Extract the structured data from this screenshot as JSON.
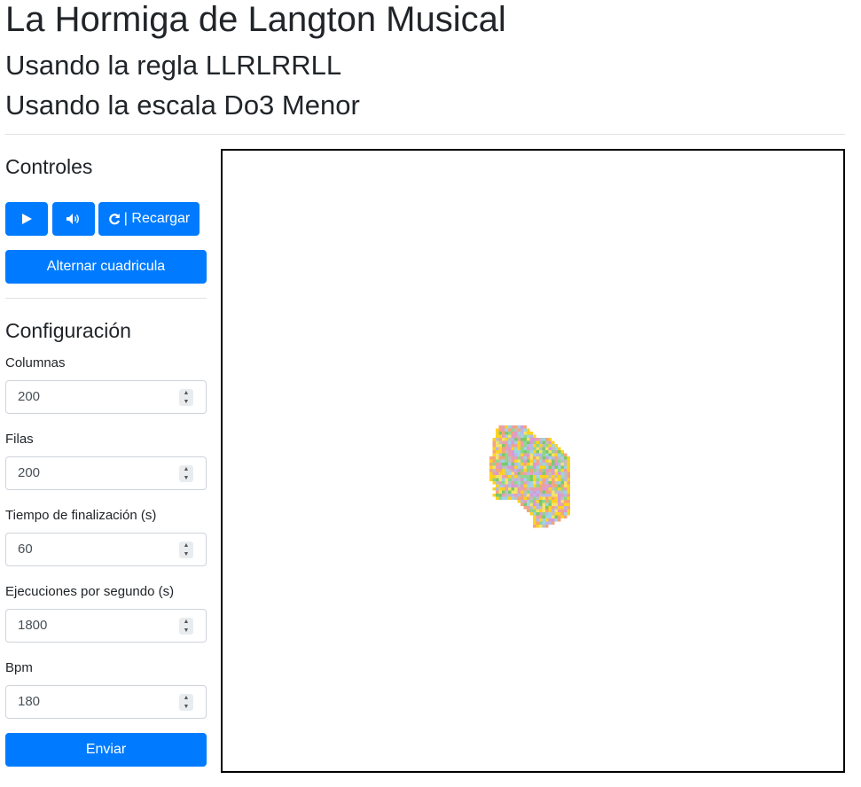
{
  "header": {
    "title": "La Hormiga de Langton Musical",
    "rule_text": "Usando la regla LLRLRRLL",
    "scale_text": "Usando la escala Do3 Menor"
  },
  "controls": {
    "title": "Controles",
    "play_icon": "play-icon",
    "sound_icon": "volume-icon",
    "reload_icon": "reload-icon",
    "reload_label": "| Recargar",
    "toggle_grid_label": "Alternar cuadricula"
  },
  "config": {
    "title": "Configuración",
    "columns_label": "Columnas",
    "columns_value": "200",
    "rows_label": "Filas",
    "rows_value": "200",
    "end_time_label": "Tiempo de finalización (s)",
    "end_time_value": "60",
    "exec_label": "Ejecuciones por segundo (s)",
    "exec_value": "1800",
    "bpm_label": "Bpm",
    "bpm_value": "180",
    "submit_label": "Enviar"
  },
  "colors": {
    "primary": "#007bff",
    "cell_palette": [
      "#ffd21f",
      "#f4a47a",
      "#bfbfbf",
      "#9fd3e6",
      "#8dd68d",
      "#d99ad4",
      "#f5e26a",
      "#b7b7e6",
      "#7cc86b",
      "#e6a0b0"
    ]
  }
}
